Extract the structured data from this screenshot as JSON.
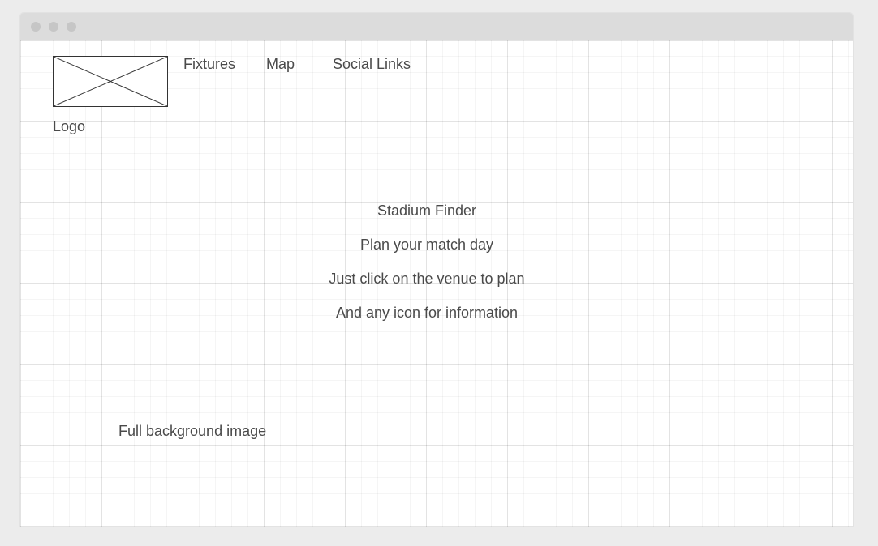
{
  "logo": {
    "label": "Logo",
    "icon": "image-placeholder-icon"
  },
  "nav": {
    "items": [
      {
        "label": "Fixtures"
      },
      {
        "label": "Map"
      },
      {
        "label": "Social Links"
      }
    ]
  },
  "hero": {
    "title": "Stadium Finder",
    "subtitle": "Plan your match day",
    "line1": "Just click on the venue to plan",
    "line2": "And any icon for information"
  },
  "background": {
    "label": "Full background image"
  }
}
